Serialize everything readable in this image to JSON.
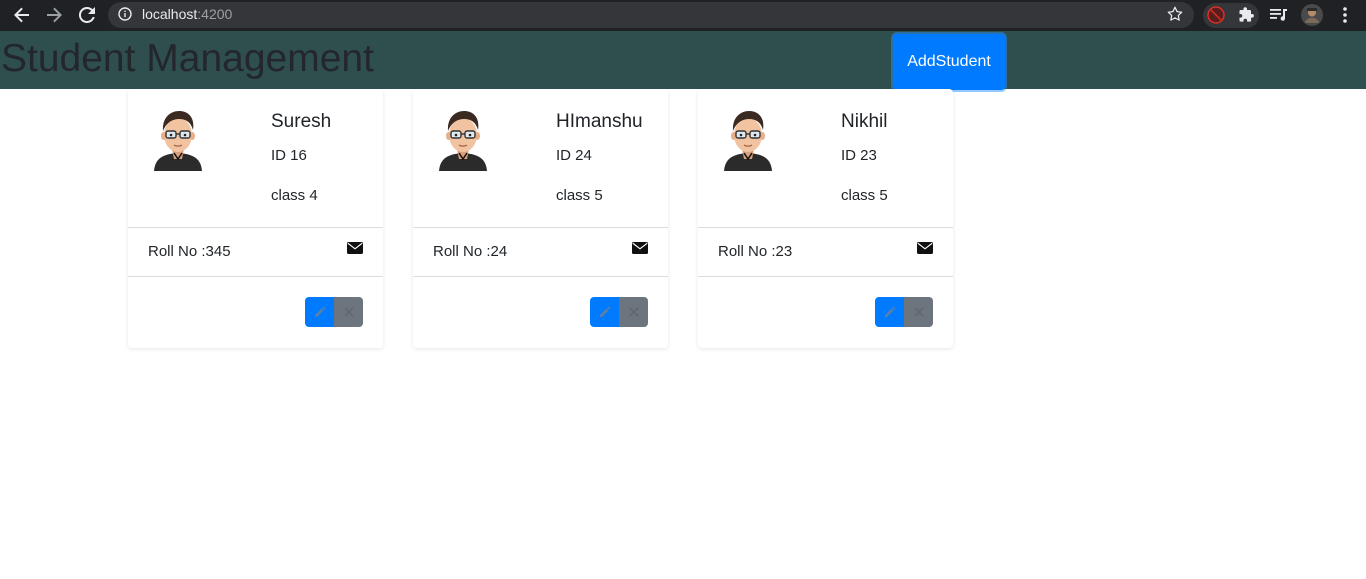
{
  "browser": {
    "url_host": "localhost",
    "url_port": ":4200",
    "icons": [
      "back-icon",
      "forward-icon",
      "reload-icon",
      "info-icon",
      "star-icon",
      "extension-icon",
      "puzzle-icon",
      "media-icon",
      "profile-avatar",
      "menu-icon"
    ]
  },
  "header": {
    "title": "Student Management",
    "add_button_label": "AddStudent",
    "background": "#2f4f4f"
  },
  "students": [
    {
      "name": "Suresh",
      "id_text": "ID 16",
      "class_text": "class 4",
      "roll_text": "Roll No :345"
    },
    {
      "name": "HImanshu",
      "id_text": "ID 24",
      "class_text": "class 5",
      "roll_text": "Roll No :24"
    },
    {
      "name": "Nikhil",
      "id_text": "ID 23",
      "class_text": "class 5",
      "roll_text": "Roll No :23"
    }
  ],
  "colors": {
    "primary": "#007bff",
    "secondary": "#6c757d"
  }
}
